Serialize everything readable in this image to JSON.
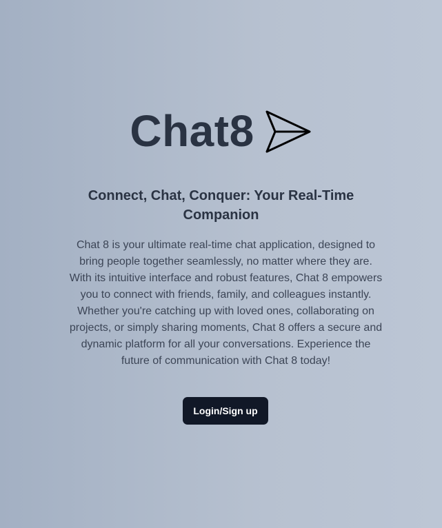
{
  "brand": {
    "title": "Chat8",
    "icon": "paper-plane-icon"
  },
  "tagline": "Connect, Chat, Conquer: Your Real-Time Companion",
  "description": "Chat 8 is your ultimate real-time chat application, designed to bring people together seamlessly, no matter where they are. With its intuitive interface and robust features, Chat 8 empowers you to connect with friends, family, and colleagues instantly. Whether you're catching up with loved ones, collaborating on projects, or simply sharing moments, Chat 8 offers a secure and dynamic platform for all your conversations. Experience the future of communication with Chat 8 today!",
  "cta": {
    "label": "Login/Sign up"
  },
  "colors": {
    "background_start": "#a3b0c3",
    "background_end": "#bcc6d5",
    "heading": "#2a3343",
    "body_text": "#3c4556",
    "button_background": "#111827",
    "button_text": "#ffffff"
  }
}
